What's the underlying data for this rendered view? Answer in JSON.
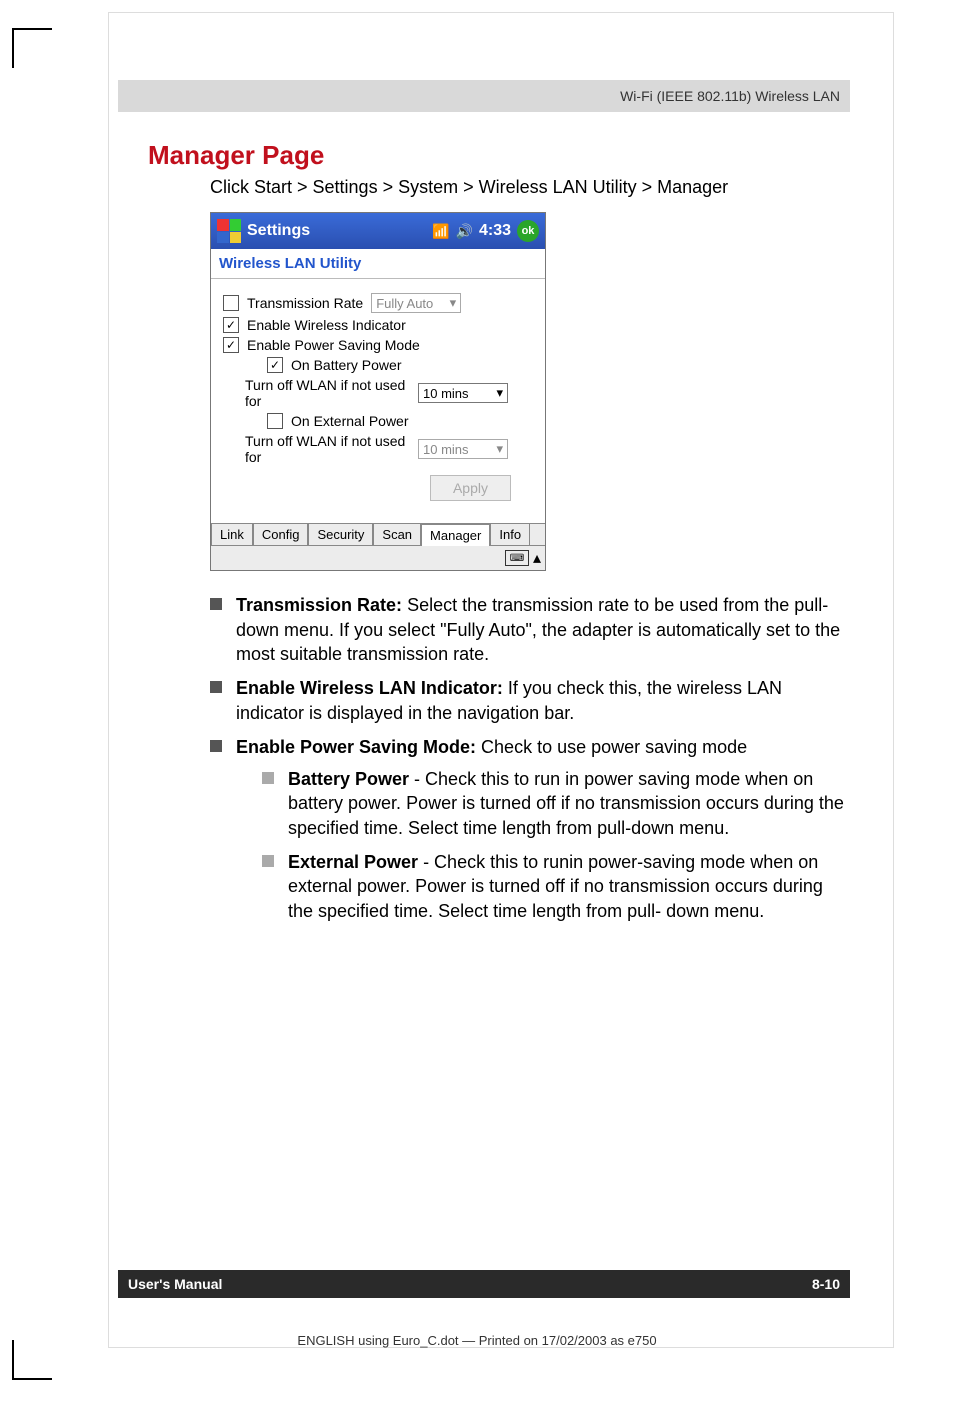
{
  "header": {
    "section_title": "Wi-Fi (IEEE 802.11b) Wireless LAN"
  },
  "page": {
    "heading": "Manager Page",
    "breadcrumb": "Click Start > Settings > System > Wireless LAN Utility > Manager"
  },
  "screenshot": {
    "titlebar": {
      "title": "Settings",
      "time": "4:33",
      "ok": "ok"
    },
    "app_title": "Wireless LAN Utility",
    "form": {
      "tx_rate": {
        "label": "Transmission Rate",
        "value": "Fully Auto",
        "checked": false,
        "enabled": false
      },
      "wlan_indicator": {
        "label": "Enable Wireless Indicator",
        "checked": true
      },
      "psm": {
        "label": "Enable Power Saving Mode",
        "checked": true
      },
      "battery": {
        "label": "On Battery Power",
        "checked": true,
        "timeout_label": "Turn off WLAN if not used for",
        "timeout_value": "10 mins",
        "timeout_enabled": true
      },
      "external": {
        "label": "On External Power",
        "checked": false,
        "timeout_label": "Turn off WLAN if not used for",
        "timeout_value": "10 mins",
        "timeout_enabled": false
      },
      "apply": "Apply"
    },
    "tabs": [
      "Link",
      "Config",
      "Security",
      "Scan",
      "Manager",
      "Info"
    ],
    "active_tab": "Manager"
  },
  "descriptions": {
    "tx_rate": {
      "title": "Transmission Rate:",
      "body": " Select the transmission rate to be used from the pull-down menu. If you select \"Fully Auto\", the adapter is automatically set to the most suitable transmission rate."
    },
    "indicator": {
      "title": "Enable Wireless LAN Indicator:",
      "body": " If you check this, the wireless LAN indicator is displayed in the navigation bar."
    },
    "psm": {
      "title": "Enable Power Saving Mode:",
      "body": " Check to use power saving mode"
    },
    "battery": {
      "title": "Battery Power",
      "body": " - Check this to run in power saving mode when on battery power. Power is turned off if no transmission occurs during the specified time. Select time length from pull-down menu."
    },
    "external": {
      "title": "External Power",
      "body": " - Check this to runin power-saving mode when on external power. Power is turned off if no transmission occurs during the specified time. Select time length from pull- down menu."
    }
  },
  "footer": {
    "left": "User's Manual",
    "right": "8-10"
  },
  "print_note": "ENGLISH using Euro_C.dot — Printed on 17/02/2003 as e750"
}
